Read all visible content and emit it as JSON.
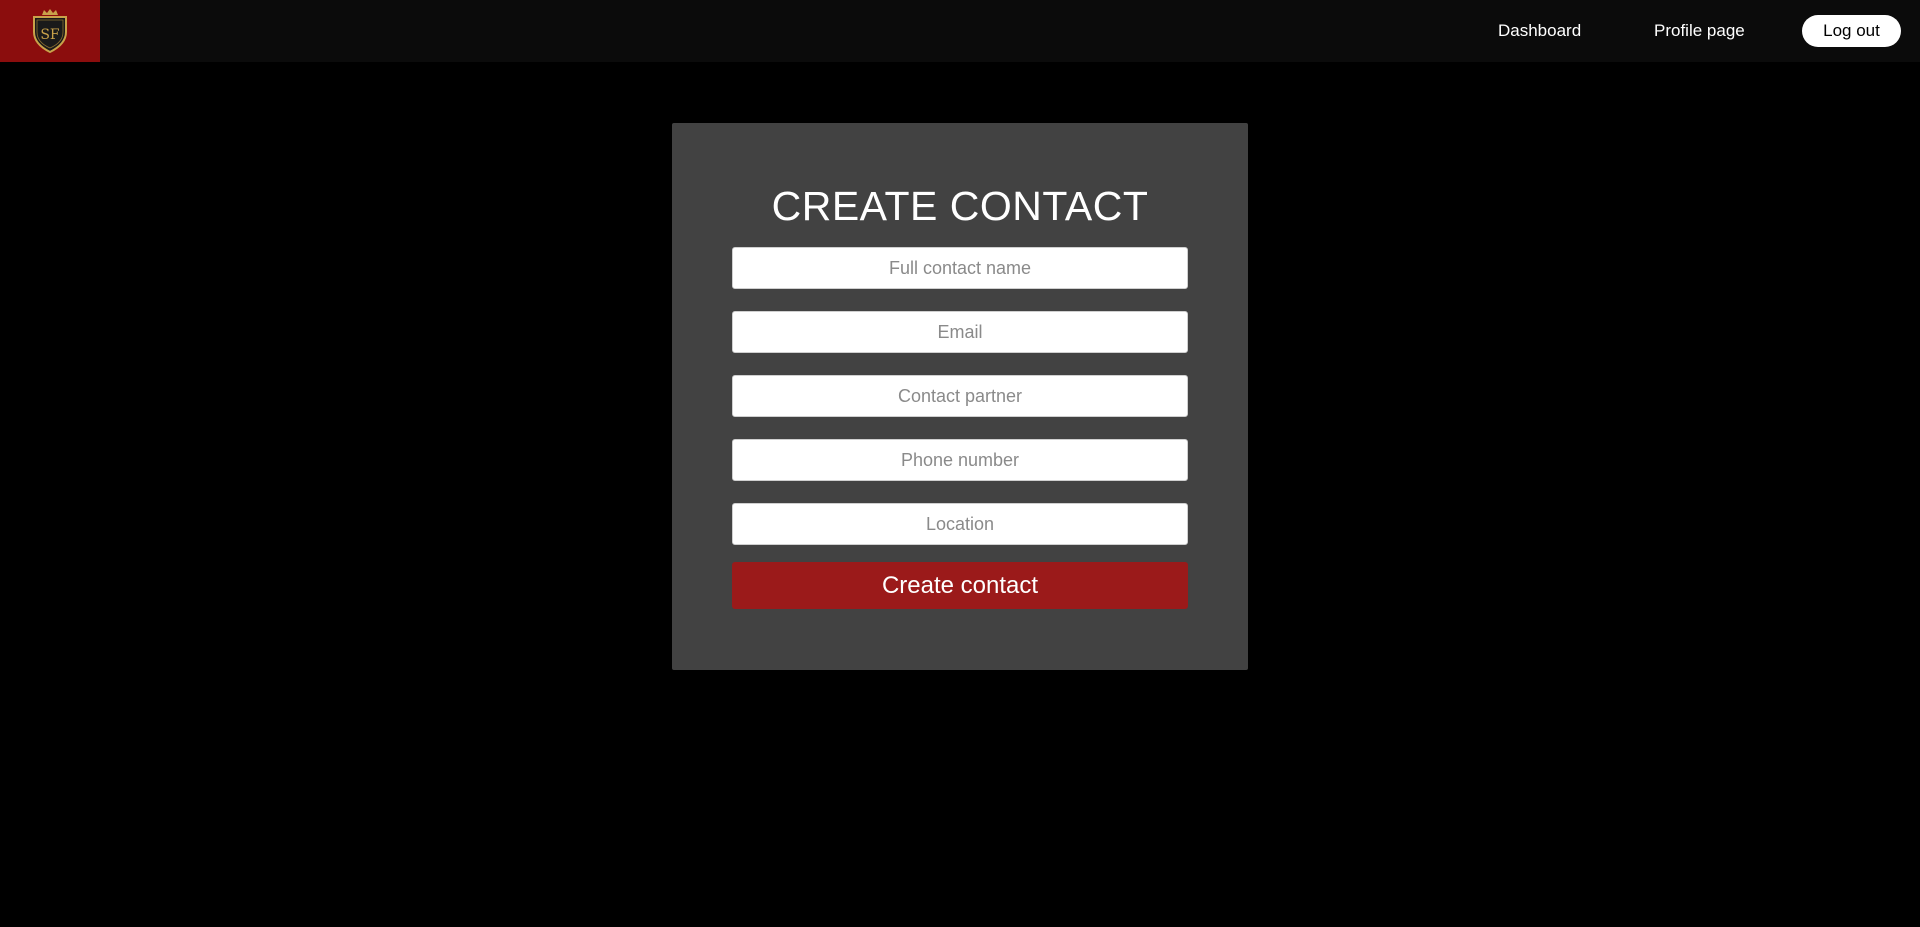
{
  "header": {
    "logo_text": "SF",
    "nav": {
      "dashboard": "Dashboard",
      "profile": "Profile page",
      "logout": "Log out"
    }
  },
  "form": {
    "title": "CREATE CONTACT",
    "fields": [
      {
        "placeholder": "Full contact name",
        "value": ""
      },
      {
        "placeholder": "Email",
        "value": ""
      },
      {
        "placeholder": "Contact partner",
        "value": ""
      },
      {
        "placeholder": "Phone number",
        "value": ""
      },
      {
        "placeholder": "Location",
        "value": ""
      }
    ],
    "submit_label": "Create contact"
  },
  "colors": {
    "page_background": "#000000",
    "topbar": "#0b0b0b",
    "logo_background": "#8b0d0d",
    "panel": "#424242",
    "accent_button": "#9b1a1a",
    "logo_gold": "#c9a24a"
  },
  "icons": {
    "logo": "shield-crest-icon"
  }
}
